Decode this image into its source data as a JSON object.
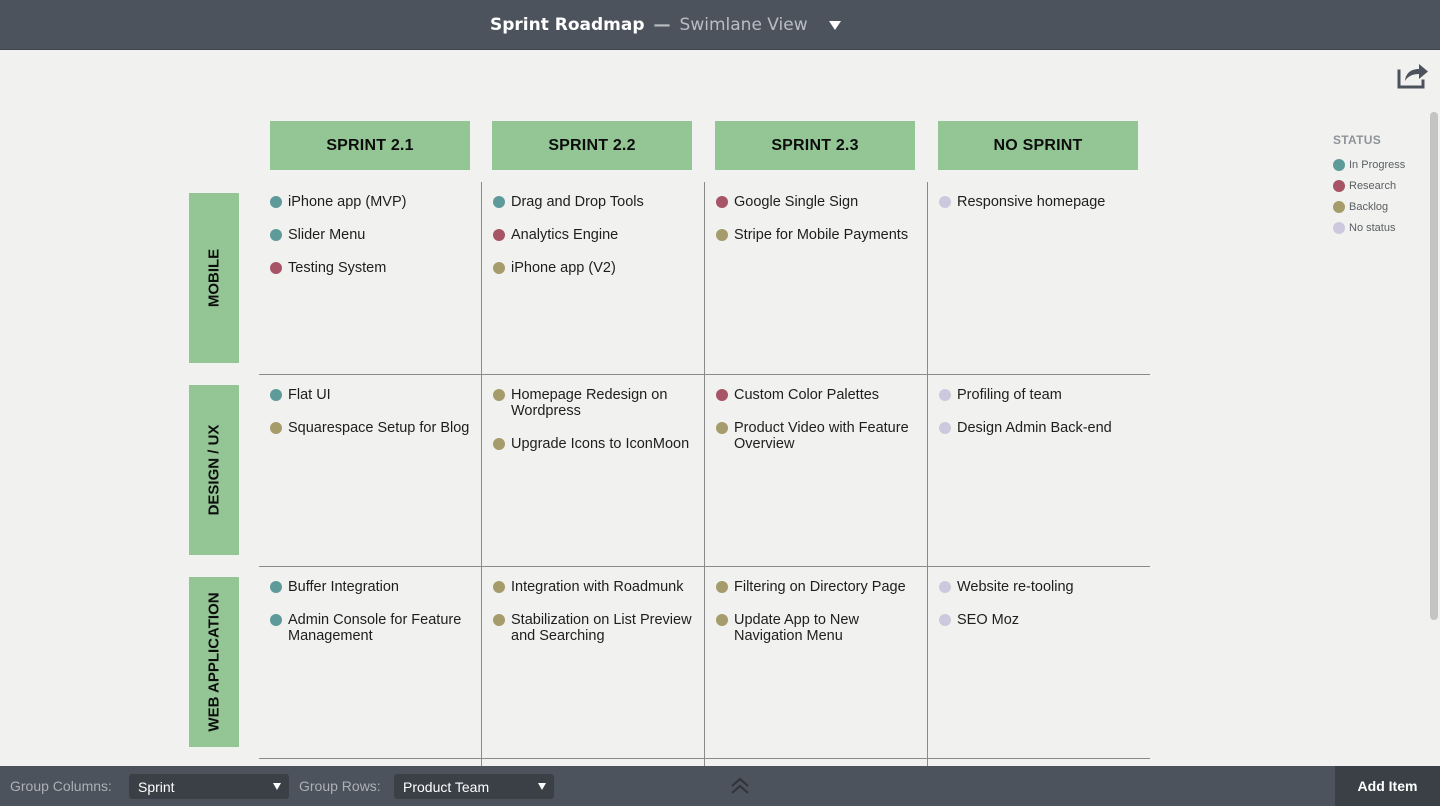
{
  "header": {
    "title": "Sprint Roadmap",
    "separator": "—",
    "view": "Swimlane View",
    "view_dropdown_icon": "triangle-down"
  },
  "share_icon": "share-arrow",
  "status_colors": {
    "in_progress": "#5e9a9a",
    "research": "#a65466",
    "backlog": "#a59b6b",
    "no_status": "#cdc8dd"
  },
  "columns": [
    "SPRINT 2.1",
    "SPRINT 2.2",
    "SPRINT 2.3",
    "NO SPRINT"
  ],
  "rows": [
    {
      "label": "MOBILE",
      "cells": [
        [
          {
            "text": "iPhone app (MVP)",
            "status": "in_progress"
          },
          {
            "text": "Slider Menu",
            "status": "in_progress"
          },
          {
            "text": "Testing System",
            "status": "research"
          }
        ],
        [
          {
            "text": "Drag and Drop Tools",
            "status": "in_progress"
          },
          {
            "text": "Analytics Engine",
            "status": "research"
          },
          {
            "text": "iPhone app (V2)",
            "status": "backlog"
          }
        ],
        [
          {
            "text": "Google Single Sign",
            "status": "research"
          },
          {
            "text": "Stripe for Mobile Payments",
            "status": "backlog"
          }
        ],
        [
          {
            "text": "Responsive homepage",
            "status": "no_status"
          }
        ]
      ]
    },
    {
      "label": "DESIGN / UX",
      "cells": [
        [
          {
            "text": "Flat UI",
            "status": "in_progress"
          },
          {
            "text": "Squarespace Setup for Blog",
            "status": "backlog"
          }
        ],
        [
          {
            "text": "Homepage Redesign on Wordpress",
            "status": "backlog"
          },
          {
            "text": "Upgrade Icons to IconMoon",
            "status": "backlog"
          }
        ],
        [
          {
            "text": "Custom Color Palettes",
            "status": "research"
          },
          {
            "text": "Product Video with Feature Overview",
            "status": "backlog"
          }
        ],
        [
          {
            "text": "Profiling of team",
            "status": "no_status"
          },
          {
            "text": "Design Admin Back-end",
            "status": "no_status"
          }
        ]
      ]
    },
    {
      "label": "WEB APPLICATION",
      "cells": [
        [
          {
            "text": "Buffer Integration",
            "status": "in_progress"
          },
          {
            "text": "Admin Console for Feature Management",
            "status": "in_progress"
          }
        ],
        [
          {
            "text": "Integration with Roadmunk",
            "status": "backlog"
          },
          {
            "text": "Stabilization on List Preview and Searching",
            "status": "backlog"
          }
        ],
        [
          {
            "text": "Filtering on Directory Page",
            "status": "backlog"
          },
          {
            "text": "Update App to New Navigation Menu",
            "status": "backlog"
          }
        ],
        [
          {
            "text": "Website re-tooling",
            "status": "no_status"
          },
          {
            "text": "SEO Moz",
            "status": "no_status"
          }
        ]
      ]
    }
  ],
  "legend": {
    "title": "STATUS",
    "items": [
      {
        "label": "In Progress",
        "status": "in_progress"
      },
      {
        "label": "Research",
        "status": "research"
      },
      {
        "label": "Backlog",
        "status": "backlog"
      },
      {
        "label": "No status",
        "status": "no_status"
      }
    ]
  },
  "footer": {
    "group_columns_label": "Group Columns:",
    "group_columns_value": "Sprint",
    "group_rows_label": "Group Rows:",
    "group_rows_value": "Product Team",
    "collapse_icon": "double-chevron-up",
    "add_item_label": "Add Item"
  }
}
